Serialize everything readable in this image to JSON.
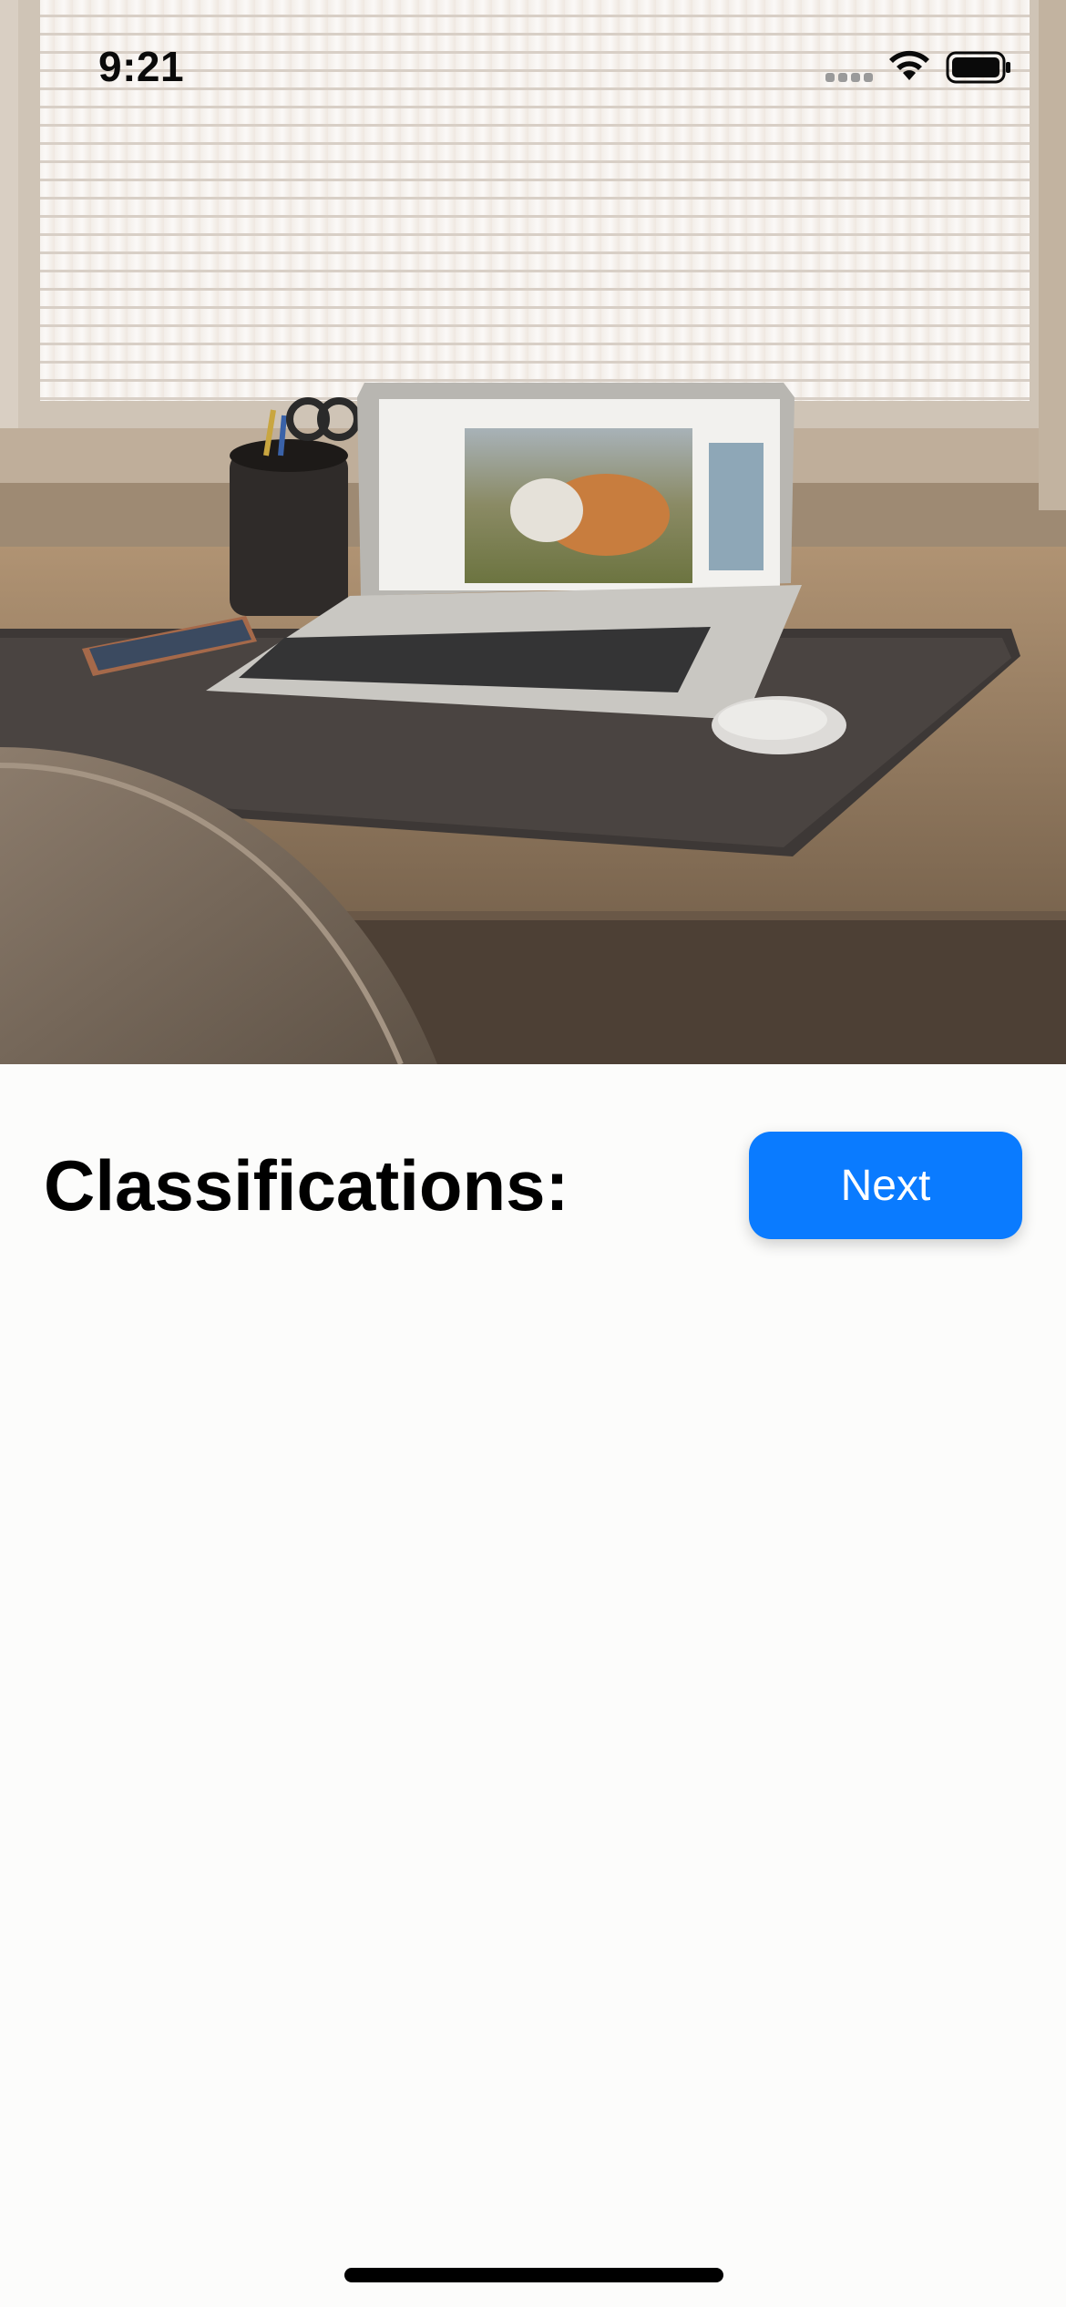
{
  "status_bar": {
    "time": "9:21",
    "icons": [
      "cellular-signal-icon",
      "wifi-icon",
      "battery-icon"
    ]
  },
  "photo": {
    "subject": "laptop-on-desk-photo"
  },
  "main": {
    "title": "Classifications:",
    "next_label": "Next",
    "classifications": []
  },
  "colors": {
    "accent": "#0a7bff",
    "background": "#fcfcfb",
    "text": "#000000"
  }
}
